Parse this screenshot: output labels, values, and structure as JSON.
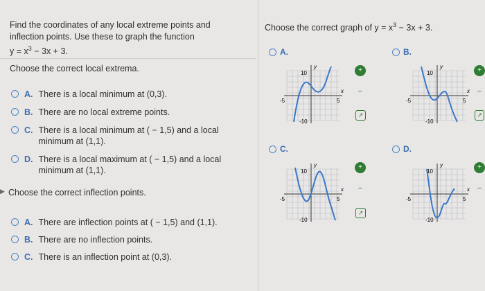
{
  "question": {
    "line1": "Find the coordinates of any local extreme points and",
    "line2": "inflection points. Use these to graph the function",
    "func_prefix": "y = x",
    "func_exp": "3",
    "func_suffix": " − 3x + 3."
  },
  "part1": {
    "prompt": "Choose the correct local extrema.",
    "options": [
      {
        "letter": "A.",
        "text": "There is a local minimum at (0,3)."
      },
      {
        "letter": "B.",
        "text": "There are no local extreme points."
      },
      {
        "letter": "C.",
        "text": "There is a local minimum at ( − 1,5) and a local minimum at (1,1)."
      },
      {
        "letter": "D.",
        "text": "There is a local maximum at ( − 1,5) and a local minimum at (1,1)."
      }
    ]
  },
  "part2": {
    "arrow": "▶",
    "prompt": "Choose the correct inflection points.",
    "options": [
      {
        "letter": "A.",
        "text": "There are inflection points at ( − 1,5) and (1,1)."
      },
      {
        "letter": "B.",
        "text": "There are no inflection points."
      },
      {
        "letter": "C.",
        "text": "There is an inflection point at (0,3)."
      }
    ]
  },
  "graph_question": {
    "prefix": "Choose the correct graph of y = x",
    "exp": "3",
    "suffix": " − 3x + 3."
  },
  "graphs": [
    {
      "letter": "A.",
      "y_label": "y",
      "x_label": "x",
      "y_top": "10",
      "y_bottom": "-10",
      "x_left": "-5",
      "x_right": "5"
    },
    {
      "letter": "B.",
      "y_label": "y",
      "x_label": "x",
      "y_top": "10",
      "y_bottom": "-10",
      "x_left": "-5",
      "x_right": "5"
    },
    {
      "letter": "C.",
      "y_label": "y",
      "x_label": "x",
      "y_top": "10",
      "y_bottom": "-10",
      "x_left": "-5",
      "x_right": "5"
    },
    {
      "letter": "D.",
      "y_label": "y",
      "x_label": "x",
      "y_top": "10",
      "y_bottom": "-10",
      "x_left": "-5",
      "x_right": "5"
    }
  ],
  "tools": {
    "zoom_in": "+",
    "zoom_out": "−",
    "popout": "↗"
  },
  "colors": {
    "accent": "#3b6fb0",
    "curve": "#3a78c8",
    "tool_green": "#2e7d32"
  }
}
